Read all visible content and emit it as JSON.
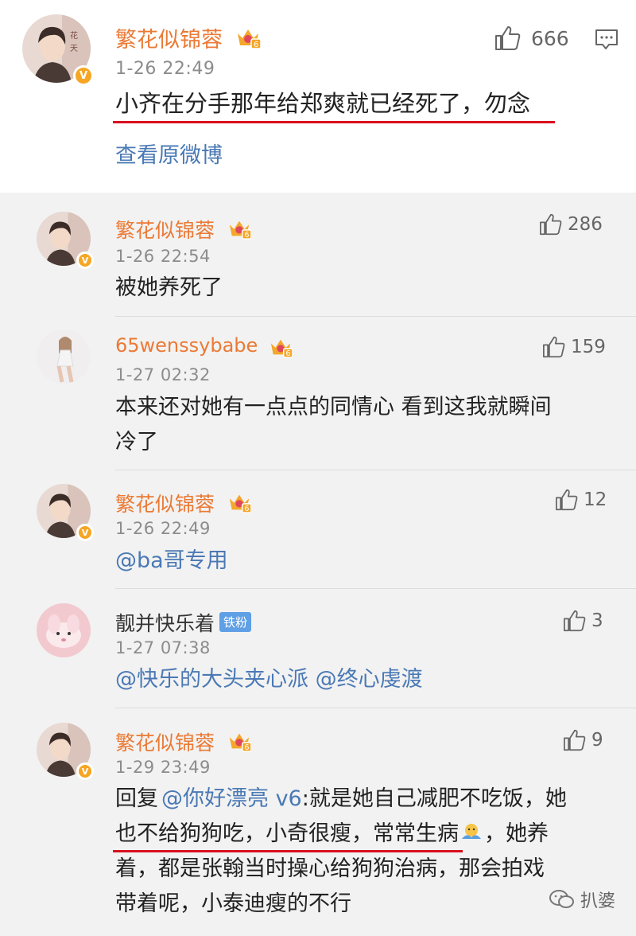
{
  "main_comment": {
    "username": "繁花似锦蓉",
    "time": "1-26 22:49",
    "likes": "666",
    "text": "小齐在分手那年给郑爽就已经死了，勿念",
    "view_original": "查看原微博"
  },
  "replies": [
    {
      "username": "繁花似锦蓉",
      "time": "1-26 22:54",
      "likes": "286",
      "text": "被她养死了"
    },
    {
      "username": "65wenssybabe",
      "time": "1-27 02:32",
      "likes": "159",
      "text_line1": "本来还对她有一点点的同情心 看到这我就瞬间",
      "text_line2": "冷了"
    },
    {
      "username": "繁花似锦蓉",
      "time": "1-26 22:49",
      "likes": "12",
      "text": "@ba哥专用"
    },
    {
      "username": "靓并快乐着",
      "badge": "铁粉",
      "time": "1-27 07:38",
      "likes": "3",
      "mention1": "@快乐的大头夹心派",
      "mention2": "@终心虔渡"
    },
    {
      "username": "繁花似锦蓉",
      "time": "1-29 23:49",
      "likes": "9",
      "reply_prefix": "回复",
      "reply_to": "@你好漂亮 v6",
      "text_line1": ":就是她自己减肥不吃饭，她",
      "text_line2": "也不给狗狗吃，小奇很瘦，常常生病",
      "text_line2b": "，她养",
      "text_line3": "着，都是张翰当时操心给狗狗治病，那会拍戏",
      "text_line4": "带着呢，小泰迪瘦的不行"
    }
  ],
  "verified_mark": "V",
  "crown_level": "6",
  "watermark": "扒婆",
  "colors": {
    "username": "#eb7a35",
    "link": "#4a79b5",
    "underline": "#d9101e",
    "background": "#f2f2f2"
  }
}
